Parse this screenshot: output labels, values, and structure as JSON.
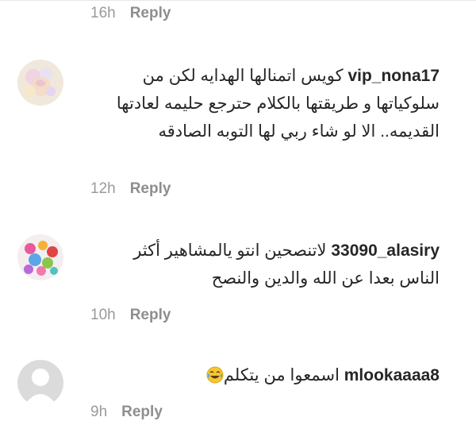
{
  "comments": [
    {
      "time": "16h",
      "reply_label": "Reply"
    },
    {
      "username": "vip_nona17",
      "text": "كويس اتمنالها الهدايه لكن من سلوكياتها و طريقتها بالكلام حترجع حليمه لعادتها القديمه.. الا لو شاء ربي لها التوبه الصادقه",
      "time": "12h",
      "reply_label": "Reply",
      "avatar_icon": "pastel-flower-avatar-icon"
    },
    {
      "username": "33090_alasiry",
      "text": "لاتنصحين انتو يالمشاهير أكثر الناس بعدا عن الله والدين والنصح",
      "time": "10h",
      "reply_label": "Reply",
      "avatar_icon": "hearts-avatar-icon"
    },
    {
      "username": "mlookaaaa8",
      "text": "اسمعوا من يتكلم",
      "emoji": "face-with-tears-of-joy-icon",
      "time": "9h",
      "reply_label": "Reply",
      "avatar_icon": "default-user-avatar-icon"
    }
  ],
  "colors": {
    "text": "#262626",
    "meta": "#8e8e8e",
    "divider": "#e8e8e8",
    "default_avatar_bg": "#dbdbdb"
  }
}
